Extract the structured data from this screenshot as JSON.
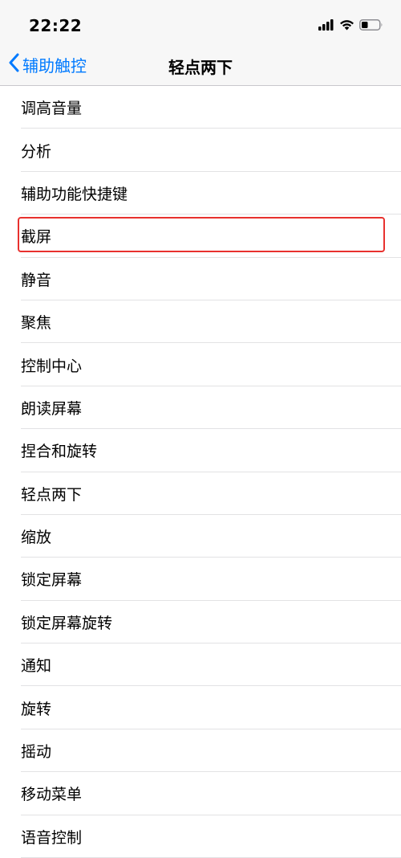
{
  "status_bar": {
    "time": "22:22",
    "icons": [
      "signal-icon",
      "wifi-icon",
      "battery-icon"
    ]
  },
  "nav": {
    "back_label": "辅助触控",
    "title": "轻点两下",
    "accent_color": "#007aff"
  },
  "list": {
    "items": [
      {
        "label": "调高音量"
      },
      {
        "label": "分析"
      },
      {
        "label": "辅助功能快捷键"
      },
      {
        "label": "截屏",
        "highlighted": true
      },
      {
        "label": "静音"
      },
      {
        "label": "聚焦"
      },
      {
        "label": "控制中心"
      },
      {
        "label": "朗读屏幕"
      },
      {
        "label": "捏合和旋转"
      },
      {
        "label": "轻点两下"
      },
      {
        "label": "缩放"
      },
      {
        "label": "锁定屏幕"
      },
      {
        "label": "锁定屏幕旋转"
      },
      {
        "label": "通知"
      },
      {
        "label": "旋转"
      },
      {
        "label": "摇动"
      },
      {
        "label": "移动菜单"
      },
      {
        "label": "语音控制"
      }
    ],
    "highlight_color": "#e8312e"
  }
}
